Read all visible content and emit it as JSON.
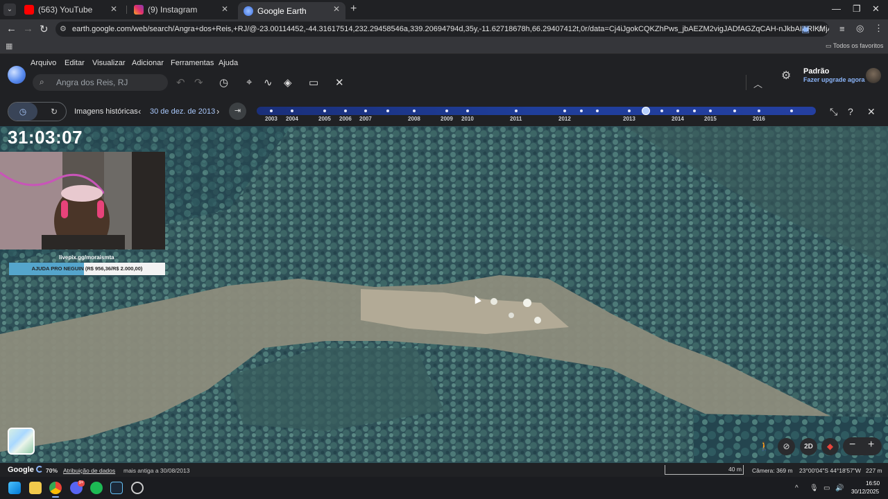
{
  "browser": {
    "tabs": [
      {
        "label": "(563) YouTube",
        "icon": "youtube-icon",
        "color": "#ff0000"
      },
      {
        "label": "(9) Instagram",
        "icon": "instagram-icon",
        "color": "#e1306c"
      },
      {
        "label": "Google Earth",
        "icon": "google-earth-icon",
        "color": "#4a7ff0"
      }
    ],
    "url": "earth.google.com/web/search/Angra+dos+Reis,+RJ/@-23.00114452,-44.31617514,232.29458546a,339.20694794d,35y,-11.62718678h,66.29407412t,0r/data=Cj4iJgokCQKZhPws_jbAEZM2vigJADfAGZqCAH-nJkbAIARlKMjAxMy0xMi0zM...",
    "bookmarks_all": "Todos os favoritos"
  },
  "earth": {
    "menu": [
      "Arquivo",
      "Editar",
      "Visualizar",
      "Adicionar",
      "Ferramentas",
      "Ajuda"
    ],
    "search_value": "Angra dos Reis, RJ",
    "profile_name": "Padrão",
    "profile_upgrade": "Fazer upgrade agora",
    "history": {
      "label": "Imagens históricas",
      "date": "30 de dez. de 2013",
      "years": [
        "2003",
        "2004",
        "2005",
        "2006",
        "2007",
        "2008",
        "2009",
        "2010",
        "2011",
        "2012",
        "2013",
        "2014",
        "2015",
        "2016"
      ],
      "selected_year": "2013"
    }
  },
  "stream": {
    "timer": "31:03:07",
    "livepix": "livepix.gg/moraismta",
    "goal_text": "AJUDA PRO NEGUIN (R$ 956,36/R$ 2.000,00)",
    "goal_progress": 0.478
  },
  "map_controls": {
    "mode_2d": "2D"
  },
  "status": {
    "brand": "Google",
    "loading": "70%",
    "attribution": "Atribuição de dados",
    "oldest": "mais antiga a 30/08/2013",
    "scale": "40 m",
    "camera": "Câmera: 369 m",
    "coords": "23°00'04\"S 44°18'57\"W",
    "altitude": "227 m"
  },
  "taskbar": {
    "time": "16:50",
    "date": "30/12/2025",
    "discord_badge": "9+"
  },
  "colors": {
    "accent": "#8ab4f8",
    "timeline": "#1f3e9a",
    "goal_fill": "#55a5cc"
  }
}
